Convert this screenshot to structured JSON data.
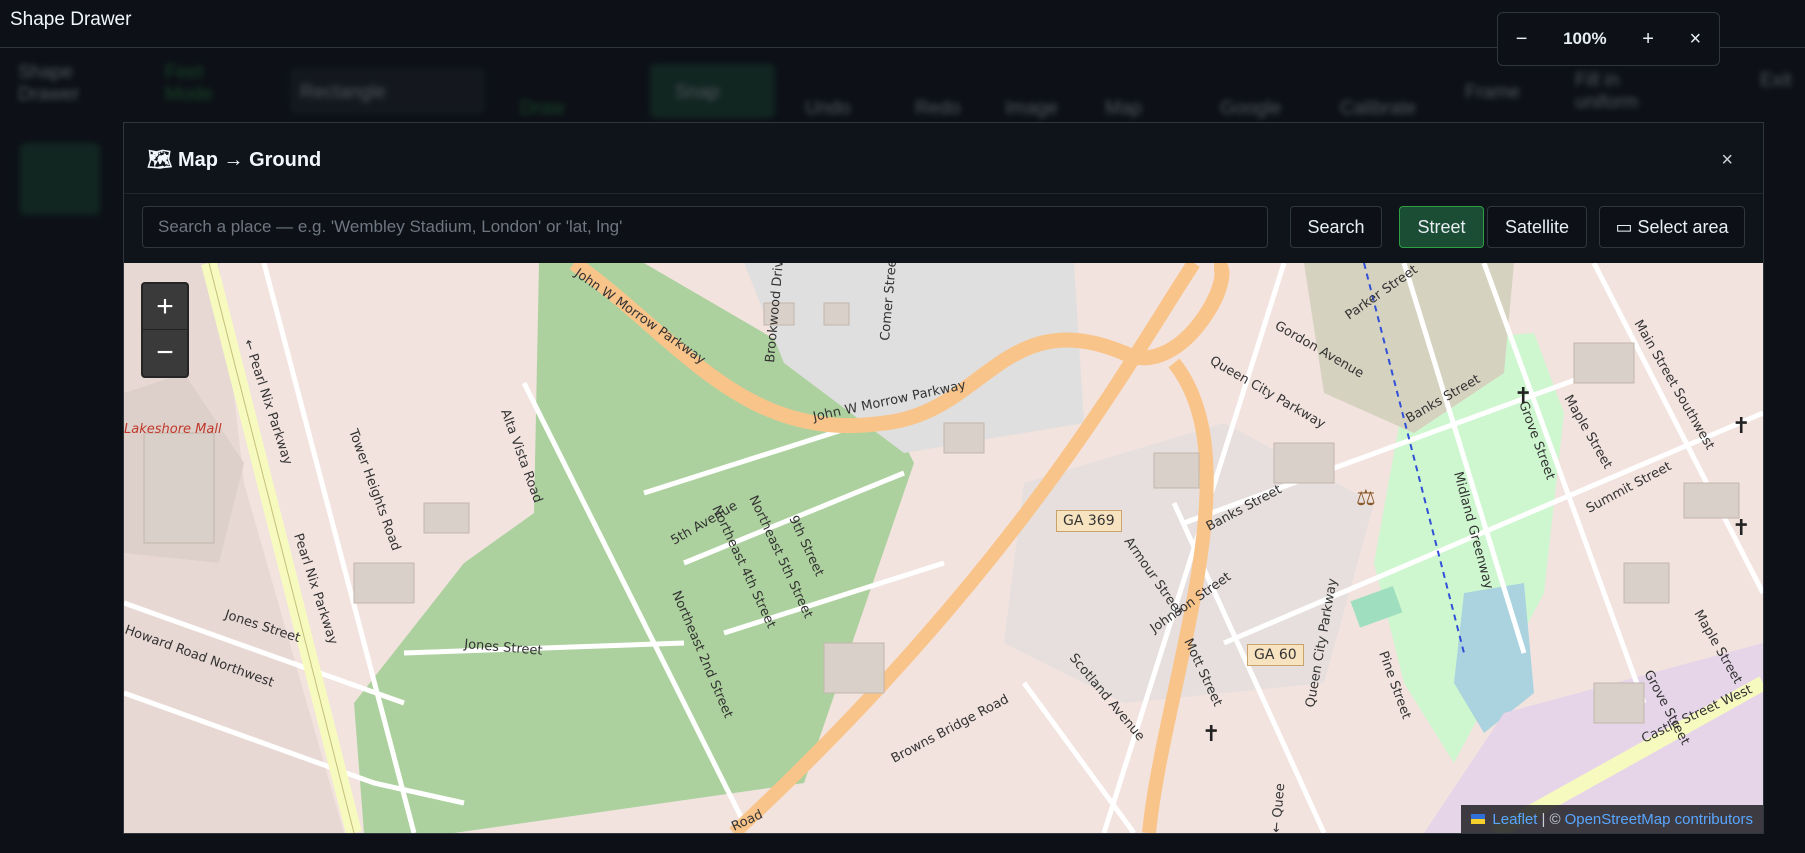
{
  "app": {
    "title": "Shape Drawer"
  },
  "zoom": {
    "minus": "−",
    "level": "100%",
    "plus": "+",
    "close": "×"
  },
  "toolbar": {
    "brand": "Shape Drawer",
    "feet_mode": "Feet Mode",
    "shape_select": "Rectangle",
    "draw": "Draw",
    "snap": "Snap",
    "undo": "Undo",
    "redo": "Redo",
    "image": "Image",
    "map": "Map",
    "google": "Google",
    "calibrate": "Calibrate",
    "frame": "Frame",
    "fill_by_unit": "Fill in uniform",
    "extra": "Exit"
  },
  "modal": {
    "title": "Map → Ground",
    "title_icon": "map-icon",
    "close": "×",
    "search_placeholder": "Search a place — e.g. 'Wembley Stadium, London' or 'lat, lng'",
    "search_value": "",
    "search_button": "Search",
    "street_button": "Street",
    "satellite_button": "Satellite",
    "select_area_button": "▭ Select area"
  },
  "map": {
    "zoom_in": "+",
    "zoom_out": "−",
    "attribution_leaflet": "Leaflet",
    "attribution_sep": "| ©",
    "attribution_osm": "OpenStreetMap contributors",
    "labels": {
      "john_morrow_1": "John W Morrow Parkway",
      "john_morrow_2": "John W Morrow Parkway",
      "pearl_nix_1": "← Pearl Nix Parkway",
      "pearl_nix_2": "Pearl Nix Parkway",
      "lakeshore": "Lakeshore Mall",
      "tower_heights": "Tower Heights Road",
      "alta_vista": "Alta Vista Road",
      "brookwood": "Brookwood Drive",
      "comer": "Comer Street",
      "queen_city_1": "Queen City Parkway",
      "queen_city_2": "Queen City Parkway",
      "gordon": "Gordon Avenue",
      "parker": "Parker Street",
      "banks_1": "Banks Street",
      "banks_2": "Banks Street",
      "grove_1": "Grove Street",
      "grove_2": "Grove Street",
      "main_sw": "Main Street Southwest",
      "maple_1": "Maple Street",
      "maple_2": "Maple Street",
      "summit": "Summit Street",
      "midland": "Midland Greenway",
      "fifth_ave": "5th Avenue",
      "ne4": "Northeast 4th Street",
      "ne5": "Northeast 5th Street",
      "ninth": "9th Street",
      "ne2": "Northeast 2nd Street",
      "jones_1": "Jones Street",
      "jones_2": "Jones Street",
      "howard": "Howard Road Northwest",
      "armour": "Armour Street",
      "johnson": "Johnson Street",
      "mott": "Mott Street",
      "scotland": "Scotland Avenue",
      "browns_bridge": "Browns Bridge Road",
      "pine": "Pine Street",
      "castle": "Castle Street West",
      "ga369": "GA 369",
      "ga60": "GA 60",
      "road": "Road",
      "queen_small": "← Quee"
    }
  }
}
